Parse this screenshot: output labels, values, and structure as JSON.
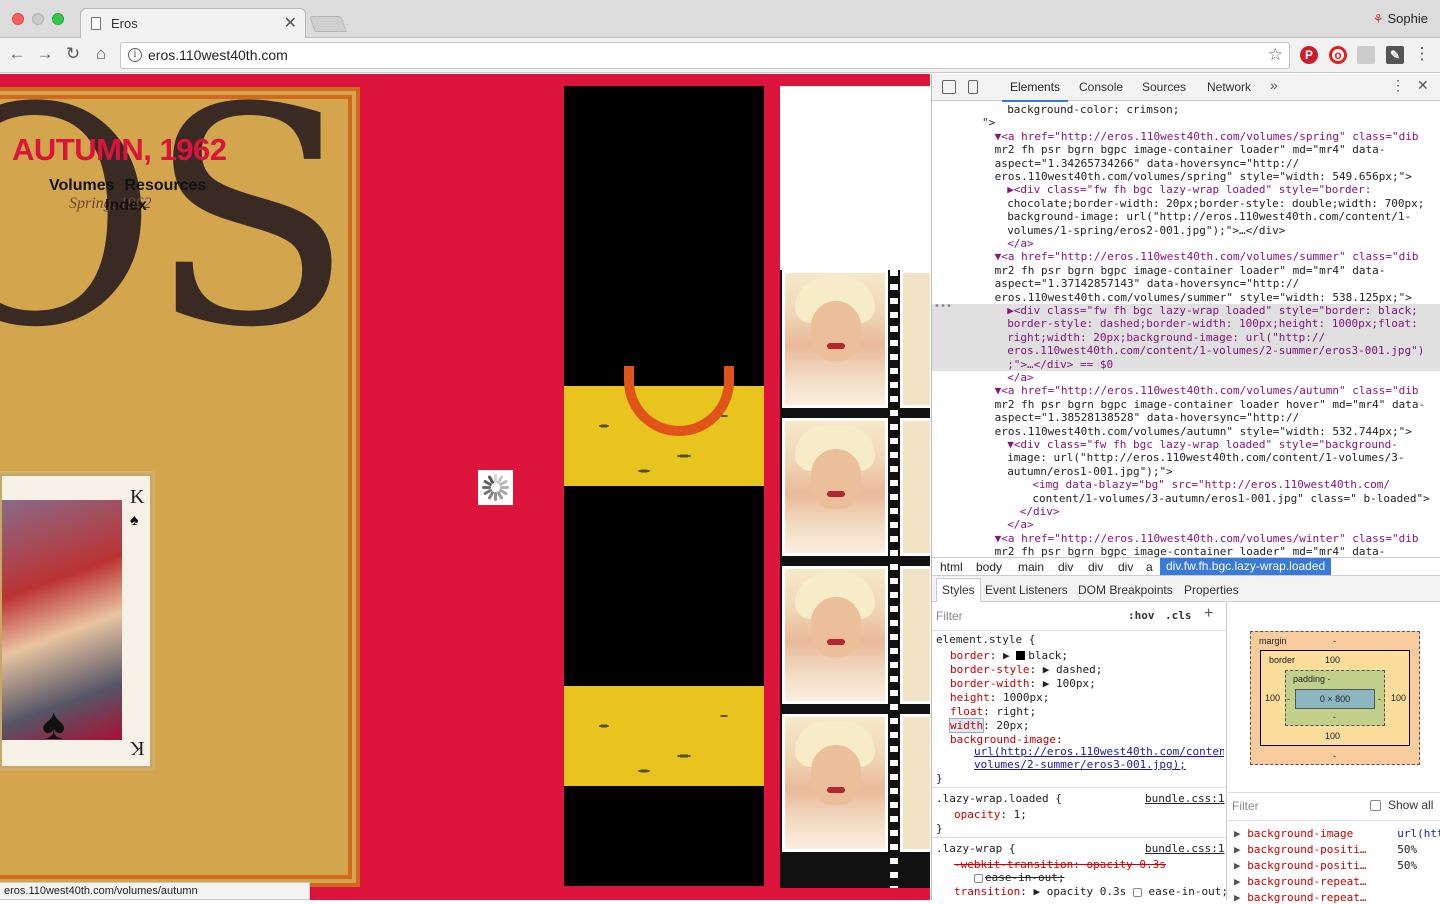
{
  "browser": {
    "tab_title": "Eros",
    "close_glyph": "✕",
    "profile_name": "Sophie",
    "url": "eros.110west40th.com",
    "status_url": "eros.110west40th.com/volumes/autumn"
  },
  "page": {
    "title": "AUTUMN, 1962",
    "nav": [
      "Volumes",
      "Resources"
    ],
    "nav_index": "Index",
    "cover_subtitle": "Spring, 1962",
    "cover_letters": "OS",
    "card_rank": "K",
    "colors": {
      "background": "#dc143c",
      "cover_border": "#d2691e"
    }
  },
  "devtools": {
    "tabs": [
      "Elements",
      "Console",
      "Sources",
      "Network"
    ],
    "active_tab": "Elements",
    "dom_lines": [
      {
        "indent": 7,
        "t": "background-color: crimson;",
        "kind": "plain"
      },
      {
        "indent": 5,
        "t": "\">",
        "kind": "plain"
      },
      {
        "indent": 6,
        "t": "▼<a href=\"http://eros.110west40th.com/volumes/spring\" class=\"dib",
        "kind": "tag"
      },
      {
        "indent": 6,
        "t": "mr2 fh psr bgrn bgpc image-container loader\" md=\"mr4\" data-",
        "kind": "plain"
      },
      {
        "indent": 6,
        "t": "aspect=\"1.34265734266\" data-hoversync=\"http://",
        "kind": "plain"
      },
      {
        "indent": 6,
        "t": "eros.110west40th.com/volumes/spring\" style=\"width: 549.656px;\">",
        "kind": "plain"
      },
      {
        "indent": 7,
        "t": "▶<div class=\"fw fh bgc lazy-wrap loaded\" style=\"border:",
        "kind": "tag"
      },
      {
        "indent": 7,
        "t": "chocolate;border-width: 20px;border-style: double;width: 700px;",
        "kind": "plain"
      },
      {
        "indent": 7,
        "t": "background-image: url(\"http://eros.110west40th.com/content/1-",
        "kind": "plain"
      },
      {
        "indent": 7,
        "t": "volumes/1-spring/eros2-001.jpg\");\">…</div>",
        "kind": "plain"
      },
      {
        "indent": 7,
        "t": "</a>",
        "kind": "tag"
      },
      {
        "indent": 6,
        "t": "▼<a href=\"http://eros.110west40th.com/volumes/summer\" class=\"dib",
        "kind": "tag"
      },
      {
        "indent": 6,
        "t": "mr2 fh psr bgrn bgpc image-container loader\" md=\"mr4\" data-",
        "kind": "plain"
      },
      {
        "indent": 6,
        "t": "aspect=\"1.37142857143\" data-hoversync=\"http://",
        "kind": "plain"
      },
      {
        "indent": 6,
        "t": "eros.110west40th.com/volumes/summer\" style=\"width: 538.125px;\">",
        "kind": "plain"
      },
      {
        "indent": 7,
        "t": "▶<div class=\"fw fh bgc lazy-wrap loaded\" style=\"border: black;",
        "kind": "sel"
      },
      {
        "indent": 7,
        "t": "border-style: dashed;border-width: 100px;height: 1000px;float:",
        "kind": "sel"
      },
      {
        "indent": 7,
        "t": "right;width: 20px;background-image: url(\"http://",
        "kind": "sel"
      },
      {
        "indent": 7,
        "t": "eros.110west40th.com/content/1-volumes/2-summer/eros3-001.jpg\")",
        "kind": "sel"
      },
      {
        "indent": 7,
        "t": ";\">…</div> == $0",
        "kind": "sel"
      },
      {
        "indent": 7,
        "t": "</a>",
        "kind": "tag"
      },
      {
        "indent": 6,
        "t": "▼<a href=\"http://eros.110west40th.com/volumes/autumn\" class=\"dib",
        "kind": "tag"
      },
      {
        "indent": 6,
        "t": "mr2 fh psr bgrn bgpc image-container loader hover\" md=\"mr4\" data-",
        "kind": "plain"
      },
      {
        "indent": 6,
        "t": "aspect=\"1.38528138528\" data-hoversync=\"http://",
        "kind": "plain"
      },
      {
        "indent": 6,
        "t": "eros.110west40th.com/volumes/autumn\" style=\"width: 532.744px;\">",
        "kind": "plain"
      },
      {
        "indent": 7,
        "t": "▼<div class=\"fw fh bgc lazy-wrap loaded\" style=\"background-",
        "kind": "tag"
      },
      {
        "indent": 7,
        "t": "image: url(\"http://eros.110west40th.com/content/1-volumes/3-",
        "kind": "plain"
      },
      {
        "indent": 7,
        "t": "autumn/eros1-001.jpg\");\">",
        "kind": "plain"
      },
      {
        "indent": 9,
        "t": "<img data-blazy=\"bg\" src=\"http://eros.110west40th.com/",
        "kind": "tag"
      },
      {
        "indent": 9,
        "t": "content/1-volumes/3-autumn/eros1-001.jpg\" class=\" b-loaded\">",
        "kind": "plain"
      },
      {
        "indent": 8,
        "t": "</div>",
        "kind": "tag"
      },
      {
        "indent": 7,
        "t": "</a>",
        "kind": "tag"
      },
      {
        "indent": 6,
        "t": "▼<a href=\"http://eros.110west40th.com/volumes/winter\" class=\"dib",
        "kind": "tag"
      },
      {
        "indent": 6,
        "t": "mr2 fh psr bgrn bgpc image-container loader\" md=\"mr4\" data-",
        "kind": "plain"
      }
    ],
    "breadcrumbs": [
      "html",
      "body",
      "main",
      "div",
      "div",
      "div",
      "a"
    ],
    "breadcrumb_active": "div.fw.fh.bgc.lazy-wrap.loaded",
    "subtabs": [
      "Styles",
      "Event Listeners",
      "DOM Breakpoints",
      "Properties"
    ],
    "filter_placeholder": "Filter",
    "hov": ":hov",
    "cls": ".cls",
    "element_style_selector": "element.style {",
    "element_style": [
      {
        "p": "border",
        "v": "black;"
      },
      {
        "p": "border-style",
        "v": "dashed;"
      },
      {
        "p": "border-width",
        "v": "100px;"
      },
      {
        "p": "height",
        "v": "1000px;"
      },
      {
        "p": "float",
        "v": "right;"
      },
      {
        "p": "width",
        "v": "20px;"
      },
      {
        "p": "background-image",
        "v": ""
      }
    ],
    "bg_url": "url(http://eros.110west40th.com/content/1-volumes/2-summer/eros3-001.jpg);",
    "rule2_selector": ".lazy-wrap.loaded {",
    "rule2_source": "bundle.css:1",
    "rule2_prop": "opacity",
    "rule2_val": "1;",
    "rule3_selector": ".lazy-wrap {",
    "rule3_source": "bundle.css:1",
    "rule3_line1": "-webkit-transition: opacity 0.3s",
    "rule3_line2": "ease-in-out;",
    "rule3_prop": "transition",
    "rule3_val": "opacity 0.3s",
    "rule3_val2": "ease-in-out;",
    "box_model": {
      "margin_label": "margin",
      "margin_val": "-",
      "border_label": "border",
      "border_val": "100",
      "padding_label": "padding -",
      "content": "0 × 800",
      "left": "100",
      "right": "100",
      "bottom": "100",
      "pad_left": "-",
      "pad_right": "-",
      "pad_bottom": "-",
      "margin_bottom": "-"
    },
    "computed_filter": "Filter",
    "show_all": "Show all",
    "computed": [
      {
        "p": "background-image",
        "v": "url(htt…"
      },
      {
        "p": "background-positi…",
        "v": "50%"
      },
      {
        "p": "background-positi…",
        "v": "50%"
      },
      {
        "p": "background-repeat…",
        "v": ""
      },
      {
        "p": "background-repeat…",
        "v": ""
      }
    ]
  }
}
